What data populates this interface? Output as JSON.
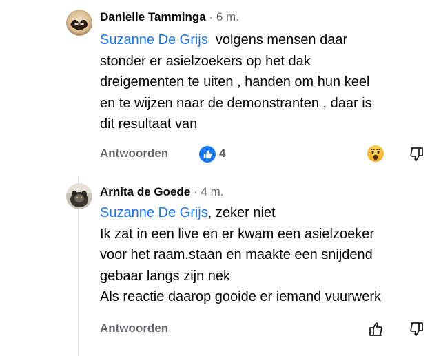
{
  "comments": [
    {
      "author": "Danielle Tamminga",
      "separator": "·",
      "time": "6 m.",
      "mention": "Suzanne De Grijs",
      "lines": [
        "volgens mensen daar",
        "stonder er asielzoekers op het dak",
        "dreigementen te uiten , handen om hun keel",
        "en te wijzen naar de demonstranten , daar is",
        "dit resultaat van"
      ],
      "reply_label": "Antwoorden",
      "like_count": "4",
      "reaction_icon": "thumbs-up-badge-icon",
      "own_reaction_icon": "wow-emoji-icon",
      "action_icon": "thumbs-down-icon"
    },
    {
      "author": "Arnita de Goede",
      "separator": "·",
      "time": "4 m.",
      "mention": "Suzanne De Grijs",
      "mention_suffix": ", zeker niet",
      "lines": [
        "Ik zat in een live en er kwam een asielzoeker",
        "voor het raam.staan en maakte een snijdend",
        "gebaar langs zijn nek",
        "Als reactie daarop gooide er iemand vuurwerk"
      ],
      "reply_label": "Antwoorden",
      "like_icon": "thumbs-up-icon",
      "dislike_icon": "thumbs-down-icon"
    }
  ],
  "colors": {
    "mention": "#1877f2",
    "meta": "#65676b",
    "text": "#050505",
    "like_badge": "#1877f2"
  }
}
